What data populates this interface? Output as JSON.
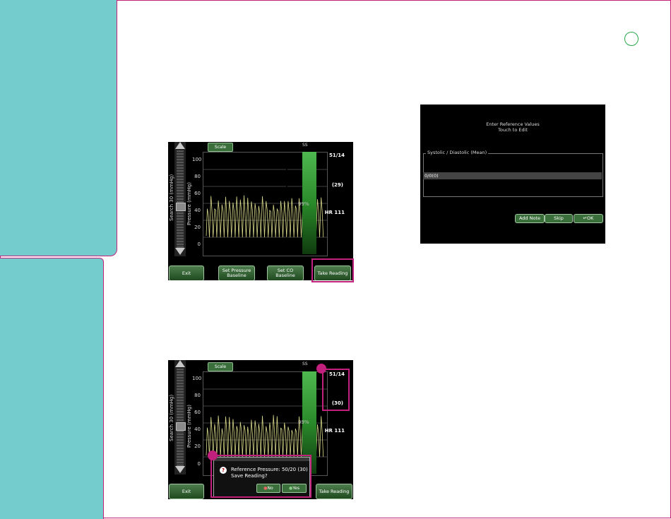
{
  "screen_a": {
    "search_label": "Search 30 (mmHg)",
    "ylabel": "Pressure (mmHg)",
    "scale_button": "Scale",
    "ticks": [
      "100",
      "80",
      "60",
      "40",
      "20",
      "0"
    ],
    "signal_label": "SS",
    "signal_percent": "99%",
    "reading_sd": "51/14",
    "reading_mean": "(29)",
    "heart_rate": "HR 111",
    "buttons": {
      "exit": "Exit",
      "set_pressure_baseline": "Set Pressure Baseline",
      "set_co_baseline": "Set CO Baseline",
      "take_reading": "Take Reading"
    }
  },
  "screen_b": {
    "search_label": "Search 30 (mmHg)",
    "ylabel": "Pressure (mmHg)",
    "scale_button": "Scale",
    "ticks": [
      "100",
      "80",
      "60",
      "40",
      "20",
      "0"
    ],
    "signal_label": "SS",
    "signal_percent": "99%",
    "reading_sd": "51/14",
    "reading_mean": "(30)",
    "heart_rate": "HR 111",
    "buttons": {
      "exit": "Exit",
      "take_reading": "Take Reading"
    },
    "dialog": {
      "line1": "Reference Pressure: 50/20 (30)",
      "line2": "Save Reading?",
      "no": "No",
      "yes": "Yes"
    }
  },
  "screen_c": {
    "title_line1": "Enter Reference Values",
    "title_line2": "Touch to Edit",
    "group_label": "Systolic / Diastolic (Mean)",
    "row_value": "0/0(0)",
    "buttons": {
      "add_note": "Add Note",
      "skip": "Skip",
      "ok": "OK"
    }
  },
  "colors": {
    "accent": "#c2207d",
    "sidebar": "#74cccc",
    "waveform": "#d8d88a",
    "button_green": "#3a6e3a"
  }
}
